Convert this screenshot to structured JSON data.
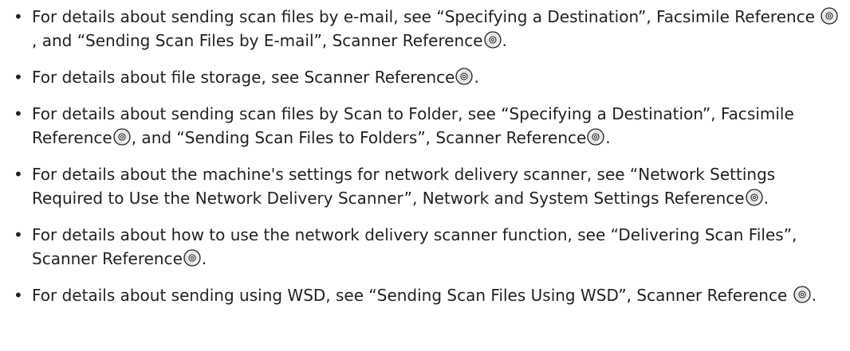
{
  "bullet_symbol": "•",
  "icon_name": "cd-rom-icon",
  "items": [
    {
      "segments": [
        "For details about sending scan files by e-mail, see “Specifying a Destination”, Facsimile Reference ",
        ", and “Sending Scan Files by E-mail”, Scanner Reference",
        "."
      ]
    },
    {
      "segments": [
        "For details about file storage, see Scanner Reference",
        "."
      ]
    },
    {
      "segments": [
        "For details about sending scan files by Scan to Folder, see “Specifying a Destination”, Facsimile Reference",
        ", and “Sending Scan Files to Folders”, Scanner Reference",
        "."
      ]
    },
    {
      "segments": [
        "For details about the machine's settings for network delivery scanner, see “Network Settings Required to Use the Network Delivery Scanner”, Network and System Settings Reference",
        "."
      ]
    },
    {
      "segments": [
        "For details about how to use the network delivery scanner function, see “Delivering Scan Files”, Scanner Reference",
        "."
      ]
    },
    {
      "segments": [
        "For details about sending using WSD, see “Sending Scan Files Using WSD”, Scanner Reference ",
        "."
      ]
    }
  ]
}
